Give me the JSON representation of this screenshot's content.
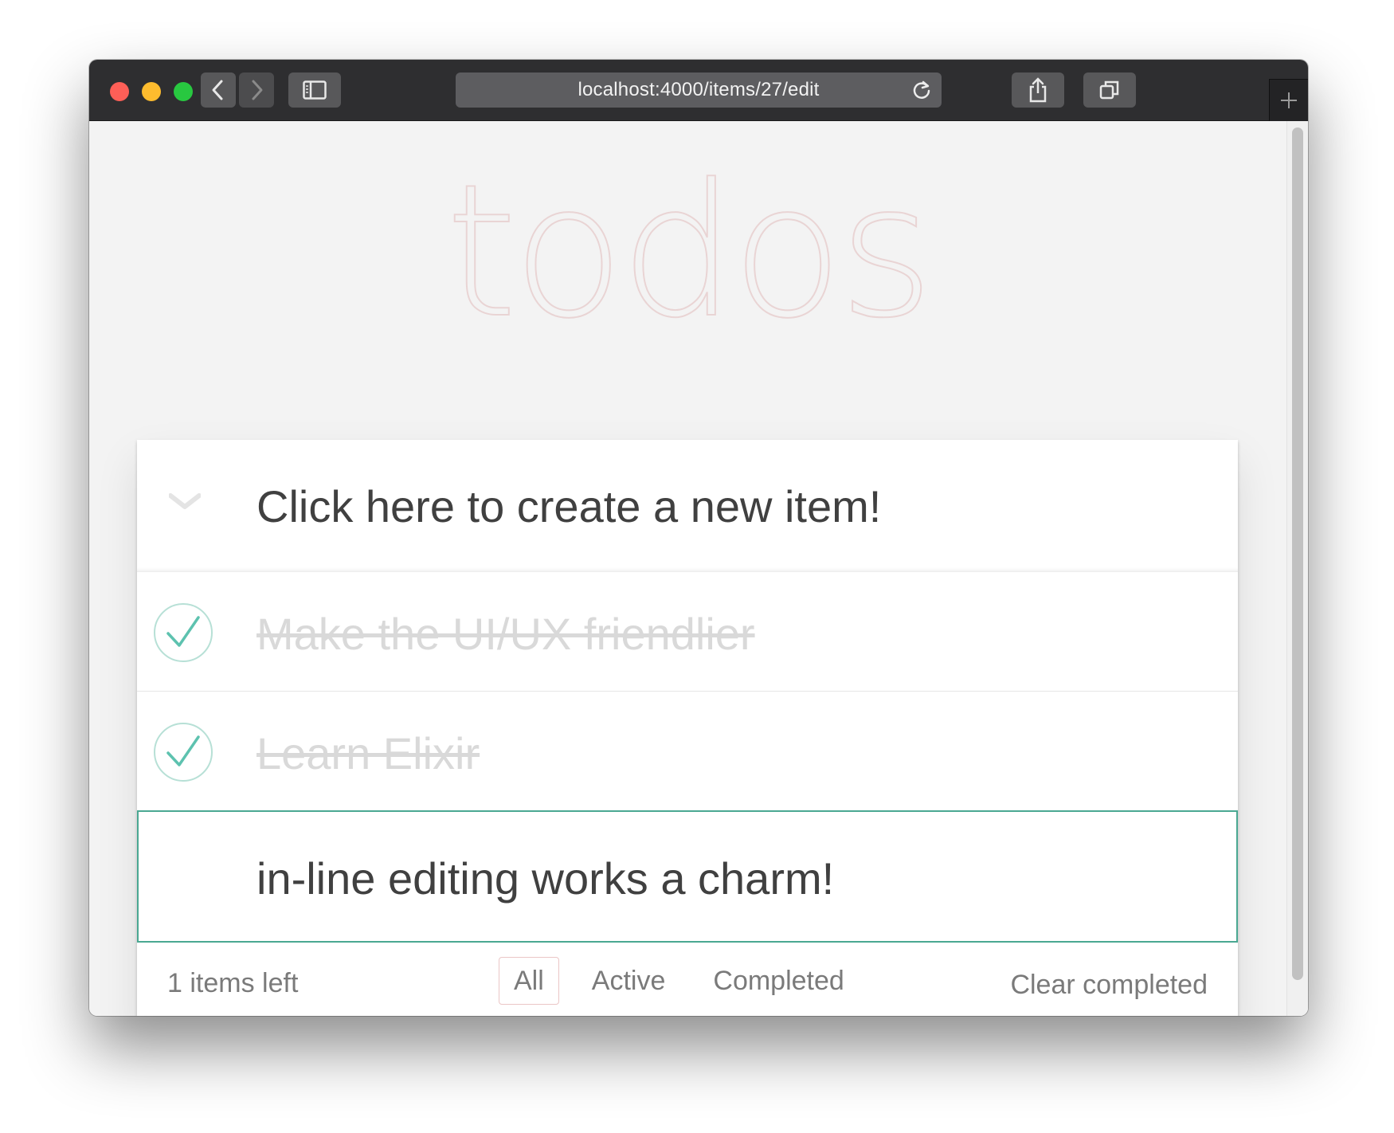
{
  "browser": {
    "url": "localhost:4000/items/27/edit",
    "icons": {
      "back": "chevron-left-icon",
      "forward": "chevron-right-icon",
      "sidebar": "sidebar-icon",
      "reload": "reload-icon",
      "share": "share-icon",
      "tabs": "tabs-icon",
      "new_tab": "plus-icon"
    }
  },
  "app": {
    "title": "todos",
    "new_item_placeholder": "Click here to create a new item!",
    "items": [
      {
        "label": "Make the UI/UX friendlier",
        "completed": true
      },
      {
        "label": "Learn Elixir",
        "completed": true
      }
    ],
    "editing_item": {
      "value": "in-line editing works a charm!"
    },
    "footer": {
      "count_text": "1 items left",
      "filters": [
        "All",
        "Active",
        "Completed"
      ],
      "selected_filter": "All",
      "clear_label": "Clear completed"
    }
  },
  "colors": {
    "accent_check": "#5dc2af",
    "edit_border": "#4aa892",
    "title_color": "#e9d4d4",
    "selected_filter_border": "#ebc6c6"
  }
}
